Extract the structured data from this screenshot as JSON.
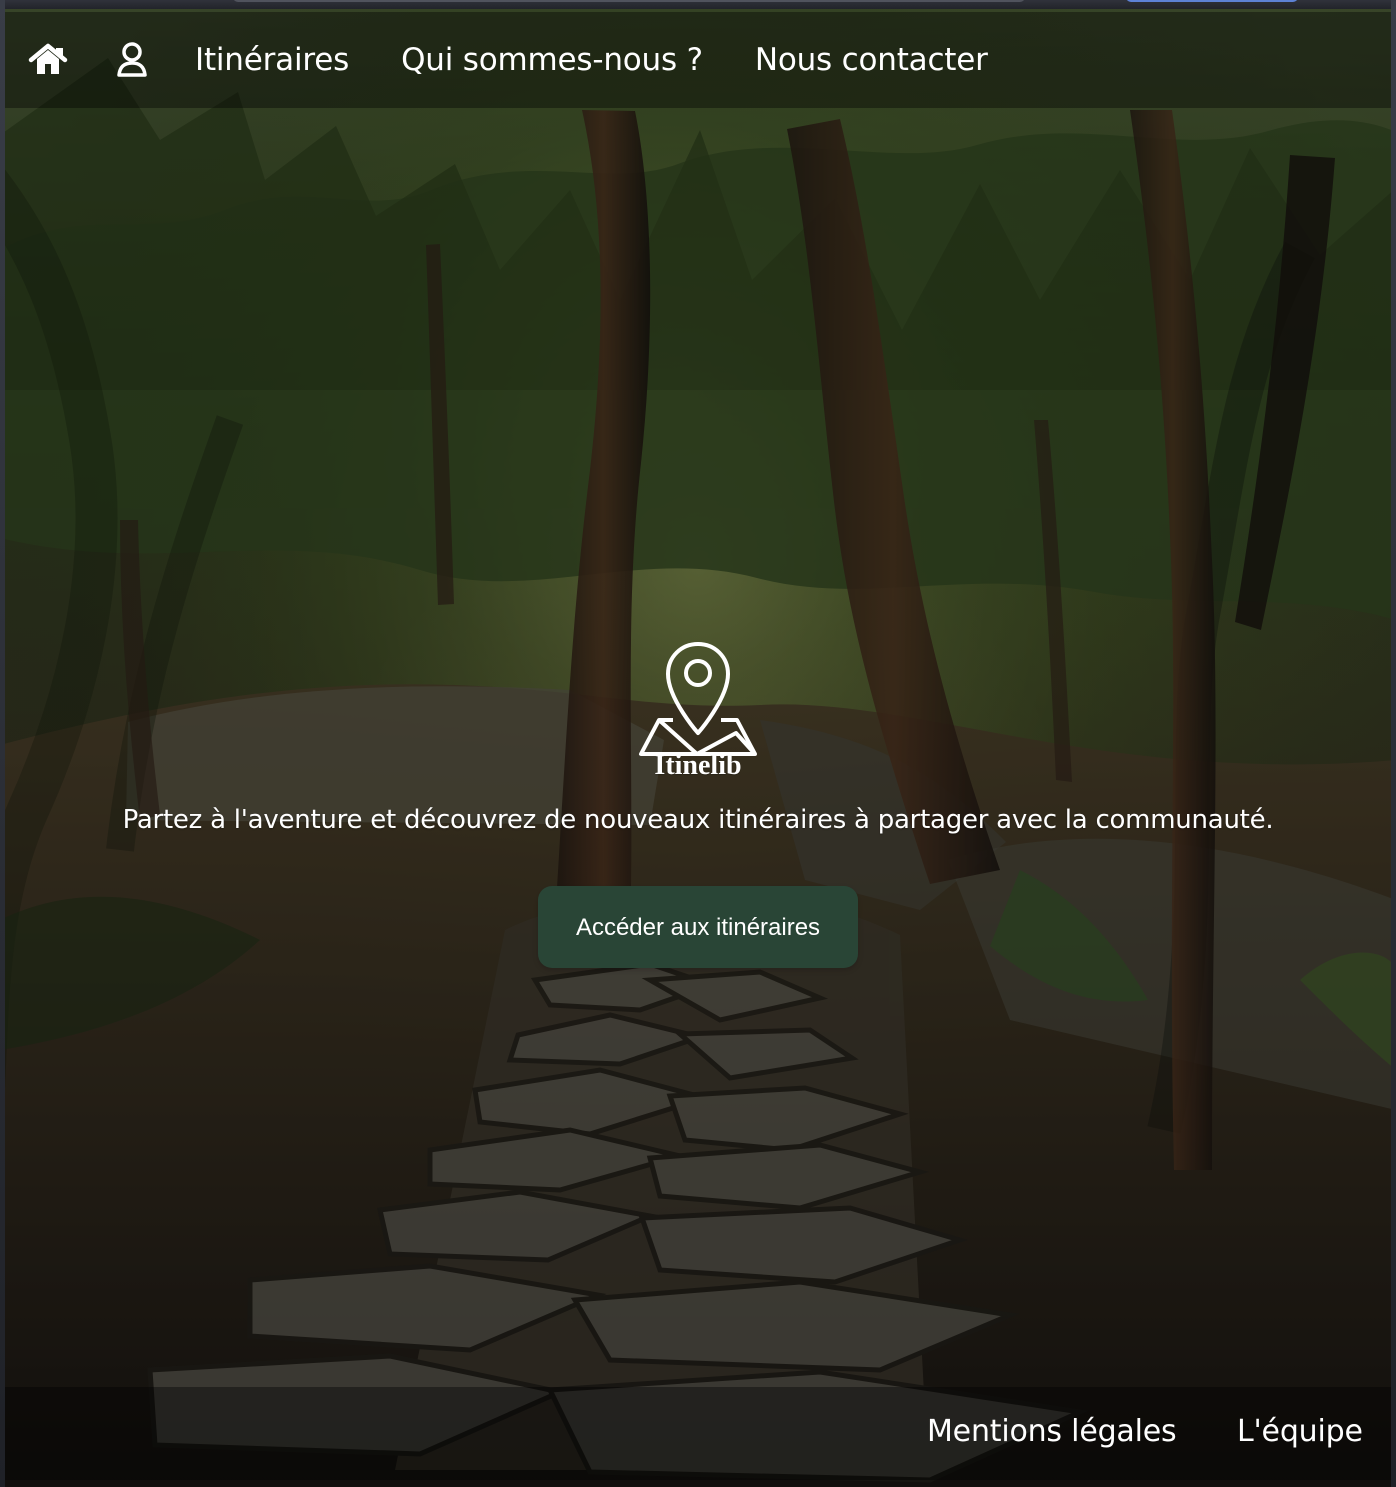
{
  "navigation": {
    "home_icon": "home-icon",
    "user_icon": "user-icon",
    "items": [
      {
        "label": "Itinéraires"
      },
      {
        "label": "Qui sommes-nous ?"
      },
      {
        "label": "Nous contacter"
      }
    ]
  },
  "hero": {
    "logo_icon": "map-pin-icon",
    "brand": "Itinelib",
    "tagline": "Partez à l'aventure et découvrez de nouveaux itinéraires à partager avec la communauté.",
    "cta_label": "Accéder aux itinéraires"
  },
  "footer": {
    "links": [
      {
        "label": "Mentions légales"
      },
      {
        "label": "L'équipe"
      }
    ]
  },
  "colors": {
    "button_background": "#294536",
    "text": "#ffffff",
    "overlay": "rgba(0, 0, 0, 0.38)"
  }
}
